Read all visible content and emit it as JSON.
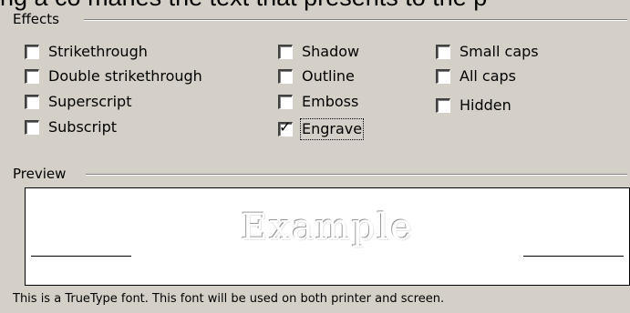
{
  "top_text": "ng a co maries the text that presents to the p",
  "effects": {
    "title": "Effects",
    "options": [
      {
        "label": "Strikethrough",
        "checked": false
      },
      {
        "label": "Double strikethrough",
        "checked": false
      },
      {
        "label": "Superscript",
        "checked": false
      },
      {
        "label": "Subscript",
        "checked": false
      },
      {
        "label": "Shadow",
        "checked": false
      },
      {
        "label": "Outline",
        "checked": false
      },
      {
        "label": "Emboss",
        "checked": false
      },
      {
        "label": "Engrave",
        "checked": true
      },
      {
        "label": "Small caps",
        "checked": false
      },
      {
        "label": "All caps",
        "checked": false
      },
      {
        "label": "Hidden",
        "checked": false
      }
    ]
  },
  "preview": {
    "title": "Preview",
    "sample_text": "Example"
  },
  "footer_text": "This is a TrueType font. This font will be used on both printer and screen."
}
